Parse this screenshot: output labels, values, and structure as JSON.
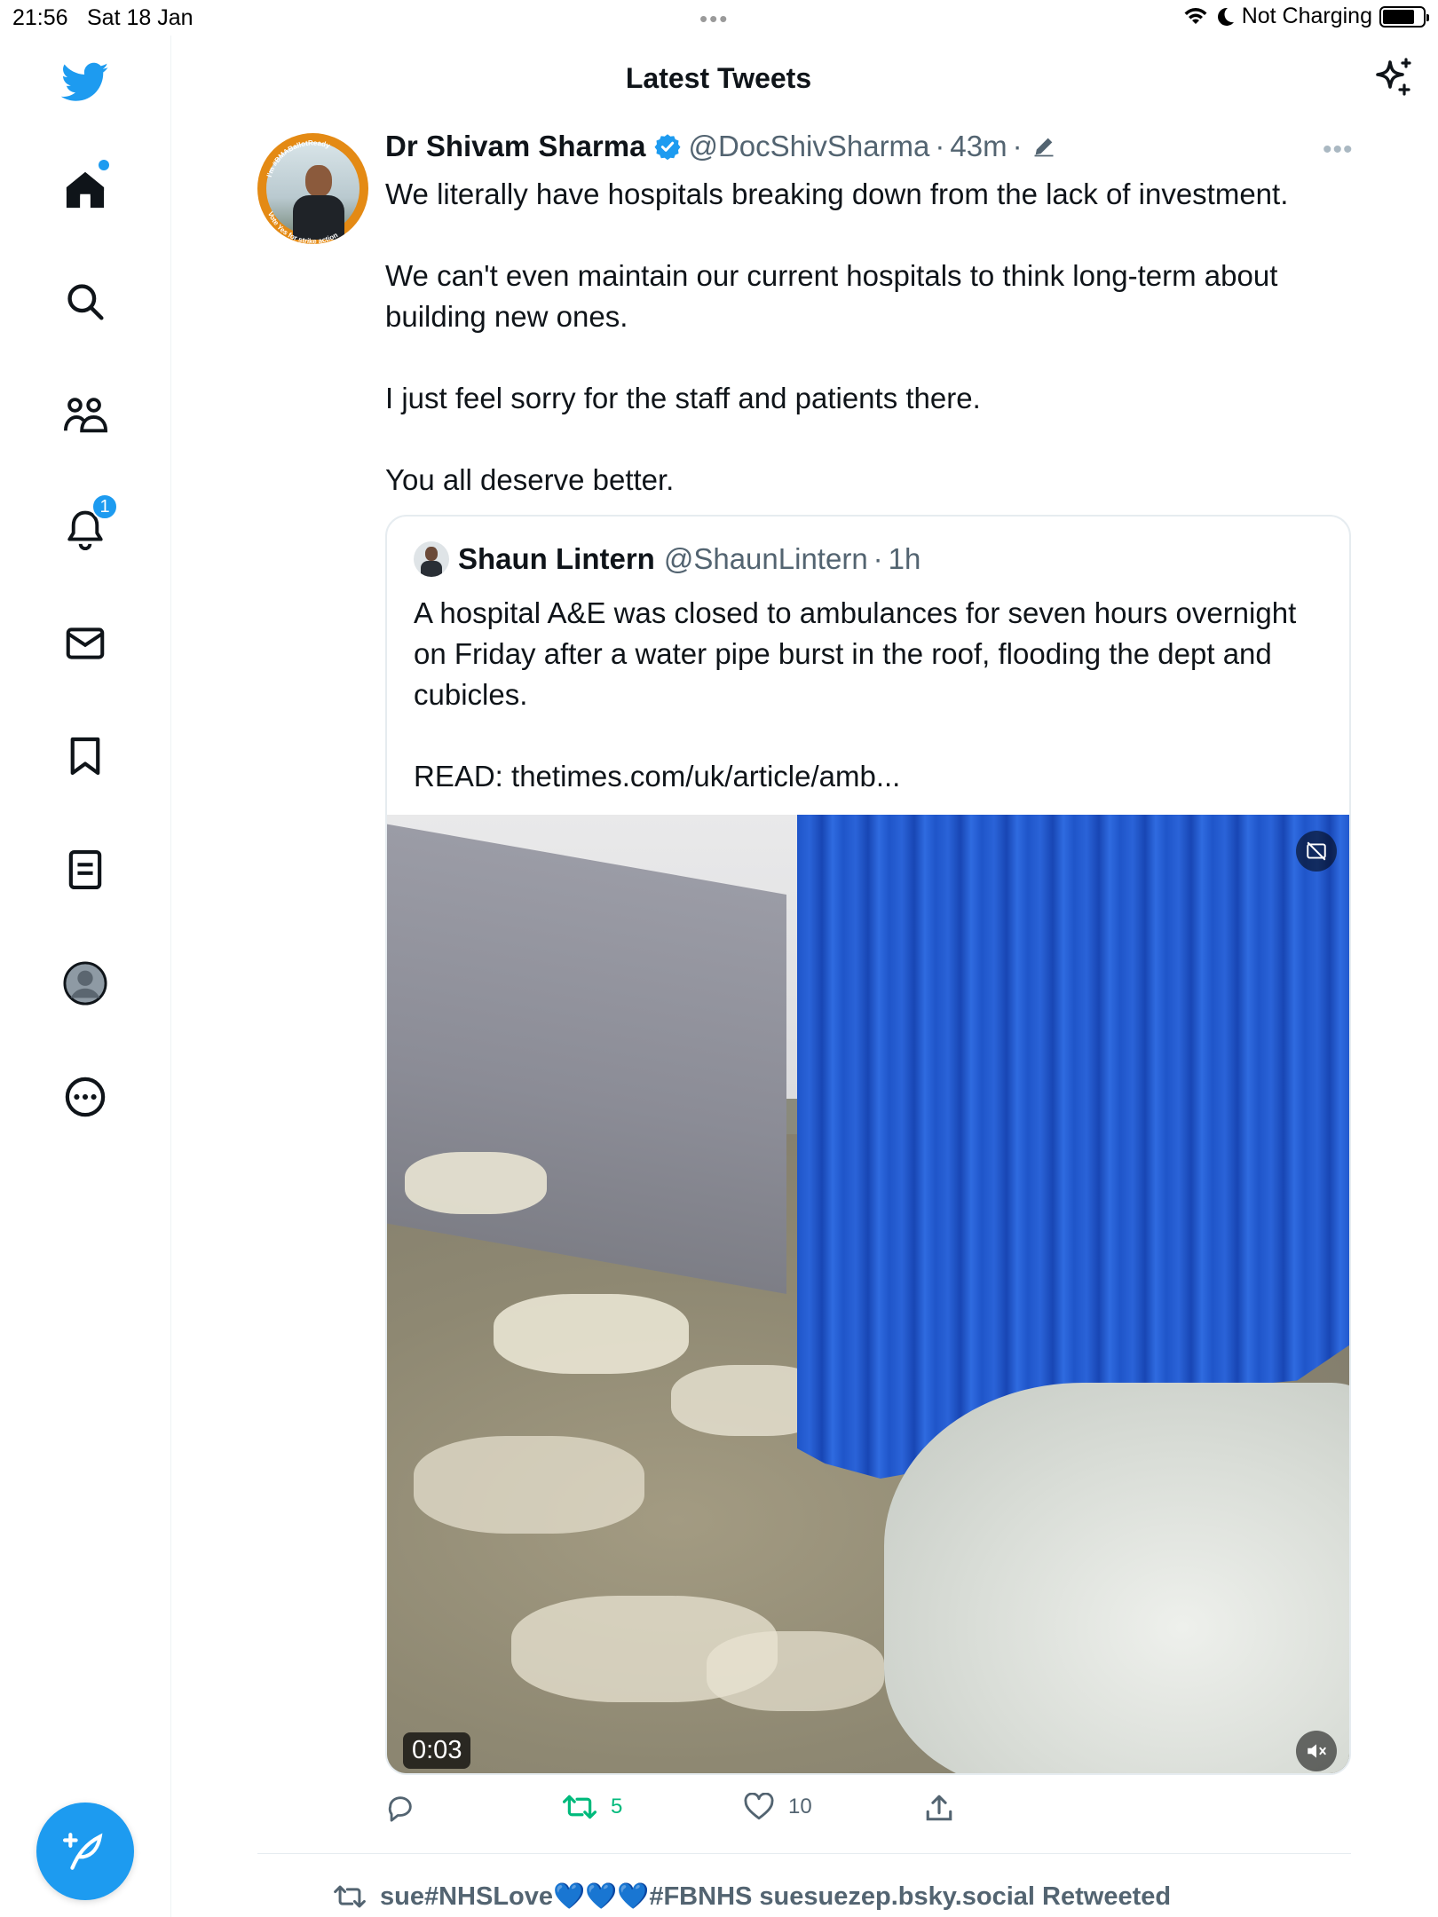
{
  "status_bar": {
    "time": "21:56",
    "date": "Sat 18 Jan",
    "dots": "•••",
    "charging": "Not Charging",
    "battery_level": 0.8
  },
  "sidebar": {
    "items": [
      {
        "name": "twitter-logo",
        "icon": "bird-icon"
      },
      {
        "name": "home",
        "icon": "home-icon",
        "has_dot": true
      },
      {
        "name": "explore",
        "icon": "search-icon"
      },
      {
        "name": "communities",
        "icon": "people-icon"
      },
      {
        "name": "notifications",
        "icon": "bell-icon",
        "badge": "1"
      },
      {
        "name": "messages",
        "icon": "mail-icon"
      },
      {
        "name": "bookmarks",
        "icon": "bookmark-icon"
      },
      {
        "name": "lists",
        "icon": "list-icon"
      },
      {
        "name": "profile",
        "icon": "avatar-icon"
      },
      {
        "name": "more",
        "icon": "more-icon"
      }
    ],
    "notification_badge": "1",
    "compose_icon": "compose-icon"
  },
  "header": {
    "title": "Latest Tweets",
    "sparkle_icon": "sparkle-icon"
  },
  "tweet": {
    "author_name": "Dr Shivam Sharma",
    "handle": "@DocShivSharma",
    "separator": "·",
    "time": "43m",
    "more": "•••",
    "avatar_ring_top": "I'm #BMABallotReady",
    "avatar_ring_bottom": "Vote Yes for strike action",
    "paragraphs": [
      "We literally have hospitals breaking down from the lack of investment.",
      "We can't even maintain our current hospitals to think long-term about building new ones.",
      "I just feel sorry for the staff and patients there.",
      "You all deserve better."
    ],
    "quote": {
      "author_name": "Shaun Lintern",
      "handle": "@ShaunLintern",
      "separator": "·",
      "time": "1h",
      "paragraphs": [
        "A hospital A&E was closed to ambulances for seven hours overnight on Friday after a water pipe burst in the roof, flooding the dept and cubicles.",
        "READ: thetimes.com/uk/article/amb..."
      ],
      "video_time": "0:03"
    },
    "actions": {
      "reply_count": "",
      "retweet_count": "5",
      "like_count": "10"
    }
  },
  "next_item": {
    "retweeted_by": "sue#NHSLove💙💙💙#FBNHS suesuezep.bsky.social Retweeted"
  },
  "colors": {
    "accent": "#1d9bf0",
    "retweet_green": "#00ba7c",
    "text": "#0f1419",
    "secondary": "#536471"
  }
}
